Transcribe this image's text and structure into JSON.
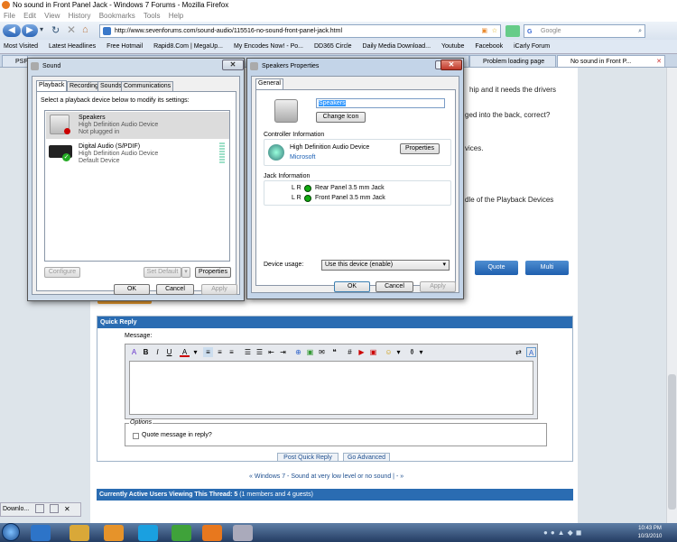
{
  "window": {
    "title": "No sound in Front Panel Jack - Windows 7 Forums - Mozilla Firefox"
  },
  "menu": [
    "File",
    "Edit",
    "View",
    "History",
    "Bookmarks",
    "Tools",
    "Help"
  ],
  "nav": {
    "url": "http://www.sevenforums.com/sound-audio/115516-no-sound-front-panel-jack.html",
    "search_placeholder": "Google"
  },
  "bookmarks": [
    "Most Visited",
    "Latest Headlines",
    "Free Hotmail",
    "Rapid8.Com | MegaUp...",
    "My Encodes Now! - Po...",
    "DD365 Circle",
    "Daily Media Download...",
    "Youtube",
    "Facebook",
    "iCarly Forum"
  ],
  "tabs": {
    "first": "PSP",
    "problem": "Problem loading page",
    "active": "No sound in Front P..."
  },
  "post": {
    "line1": "hip and it needs the drivers",
    "line2": "ged into the back, correct?",
    "line3": "vices.",
    "line4": "dle of the Playback Devices",
    "quote": "Quote",
    "multi": "Multi"
  },
  "quick_reply": {
    "title": "Quick Reply",
    "message_label": "Message:",
    "options_label": "Options",
    "quote_checkbox": "Quote message in reply?",
    "post_button": "Post Quick Reply",
    "advanced_button": "Go Advanced"
  },
  "thread_nav": {
    "prefix": "«",
    "link": "Windows 7 - Sound at very low level or no sound",
    "sep": "|",
    "dash": "-",
    "suffix": "»"
  },
  "active_users": {
    "label": "Currently Active Users Viewing This Thread: 5",
    "detail": "(1 members and 4 guests)"
  },
  "sound": {
    "title": "Sound",
    "tabs": [
      "Playback",
      "Recording",
      "Sounds",
      "Communications"
    ],
    "instruction": "Select a playback device below to modify its settings:",
    "devices": [
      {
        "name": "Speakers",
        "line2": "High Definition Audio Device",
        "line3": "Not plugged in"
      },
      {
        "name": "Digital Audio (S/PDIF)",
        "line2": "High Definition Audio Device",
        "line3": "Default Device"
      }
    ],
    "configure": "Configure",
    "set_default": "Set Default",
    "properties": "Properties",
    "ok": "OK",
    "cancel": "Cancel",
    "apply": "Apply"
  },
  "speakers": {
    "title": "Speakers Properties",
    "tab": "General",
    "name_value": "Speakers",
    "change_icon": "Change Icon",
    "controller_label": "Controller Information",
    "controller_name": "High Definition Audio Device",
    "controller_vendor": "Microsoft",
    "controller_props": "Properties",
    "jack_label": "Jack Information",
    "jacks": [
      {
        "lr": "L R",
        "name": "Rear Panel 3.5 mm Jack"
      },
      {
        "lr": "L R",
        "name": "Front Panel 3.5 mm Jack"
      }
    ],
    "usage_label": "Device usage:",
    "usage_value": "Use this device (enable)",
    "ok": "OK",
    "cancel": "Cancel",
    "apply": "Apply"
  },
  "taskbar": {
    "download": "Downlo...",
    "time": "10:43 PM",
    "date": "10/3/2010"
  }
}
